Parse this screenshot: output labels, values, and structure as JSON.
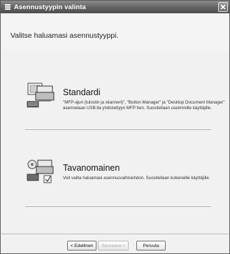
{
  "window": {
    "title": "Asennustyypin valinta",
    "close_icon": "close-icon"
  },
  "main": {
    "heading": "Valitse haluamasi asennustyyppi."
  },
  "options": [
    {
      "title": "Standardi",
      "description": "\"MFP-ajuri (tulostin ja skanneri)\", \"Button Manager\" ja \"Desktop Document Manager\" asennetaan USB:lla yhdistettyyn MFP:hen. Suositellaan useimmille käyttäjille.",
      "icon": "standard-install-icon"
    },
    {
      "title": "Tavanomainen",
      "description": "Voit valita haluamasi asennusvaihtoehdon. Suositellaan kokeneille käyttäjille.",
      "icon": "custom-install-icon"
    }
  ],
  "footer": {
    "back_label": "< Edellinen",
    "next_label": "Seuraava >",
    "cancel_label": "Peruuta"
  },
  "colors": {
    "titlebar": "#5f5f5f",
    "background": "#f1f1f1"
  }
}
